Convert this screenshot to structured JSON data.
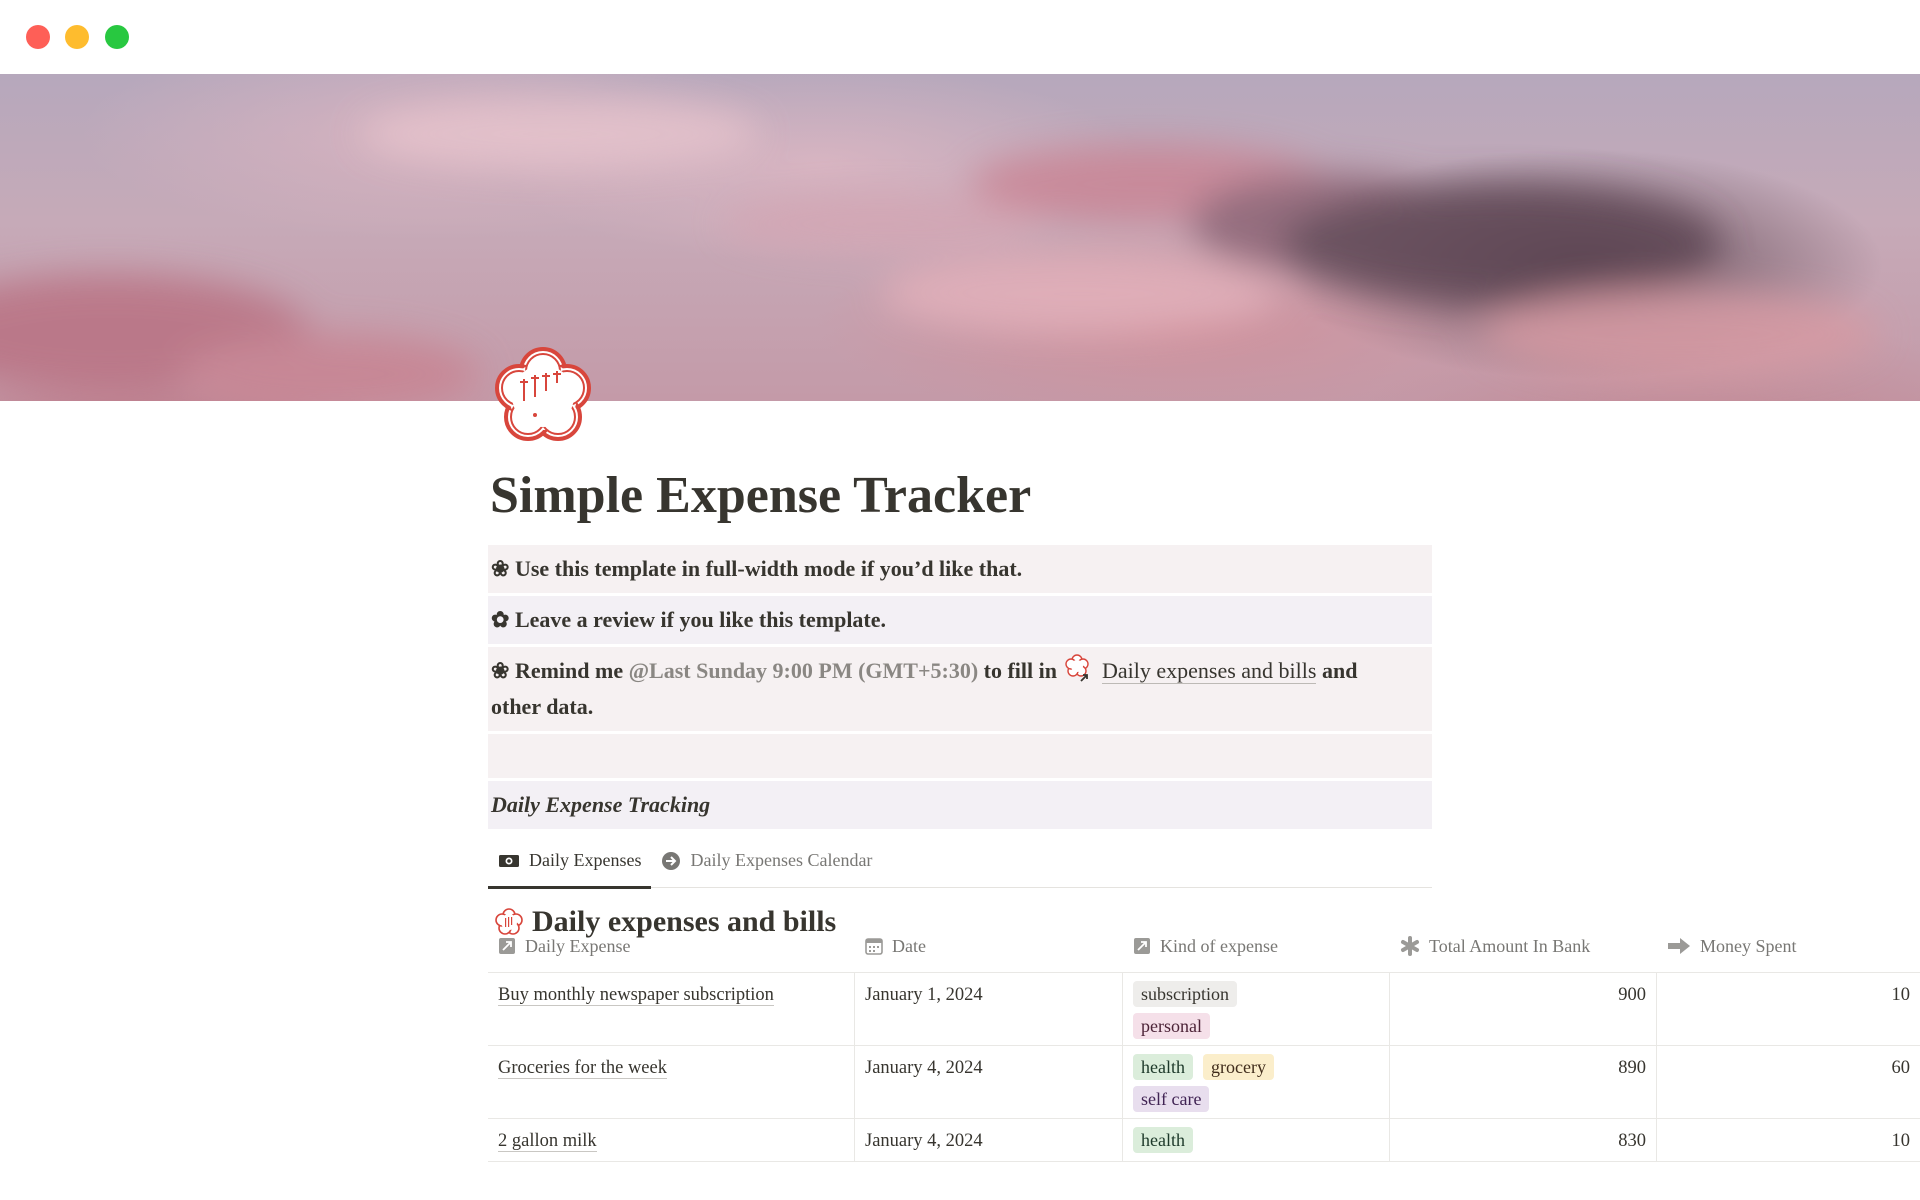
{
  "page": {
    "title": "Simple Expense Tracker",
    "icon": "sakura-stamp-icon",
    "icon_text": "大変よくできました。"
  },
  "callout": {
    "line1": "Use this template in full-width mode if you’d like that.",
    "line2": "Leave a review if you like this template.",
    "line3_prefix": "Remind me",
    "reminder": "@Last Sunday 9:00 PM (GMT+5:30)",
    "line3_middle": "to fill in",
    "linked_page": "Daily expenses and bills",
    "line3_suffix": "and",
    "line3_end": "other data.",
    "section": "Daily Expense Tracking"
  },
  "tabs": [
    {
      "label": "Daily Expenses",
      "icon": "money-icon",
      "active": true
    },
    {
      "label": "Daily Expenses Calendar",
      "icon": "arrow-circle-icon",
      "active": false
    }
  ],
  "database": {
    "title": "Daily expenses and bills",
    "columns": [
      "Daily Expense",
      "Date",
      "Kind of expense",
      "Total Amount In Bank",
      "Money Spent"
    ],
    "rows": [
      {
        "name": "Buy monthly newspaper subscription",
        "date": "January 1, 2024",
        "kinds": [
          "subscription",
          "personal"
        ],
        "bank": "900",
        "spent": "10"
      },
      {
        "name": "Groceries for the week",
        "date": "January 4, 2024",
        "kinds": [
          "health",
          "grocery",
          "self care"
        ],
        "bank": "890",
        "spent": "60"
      },
      {
        "name": "2 gallon milk",
        "date": "January 4, 2024",
        "kinds": [
          "health"
        ],
        "bank": "830",
        "spent": "10"
      }
    ]
  },
  "colors": {
    "accent_red": "#d8463c",
    "tag_subscription": "#eeedeb",
    "tag_personal": "#f5e0e9",
    "tag_health": "#dbeddb",
    "tag_grocery": "#fbeecb",
    "tag_self_care": "#e8deee"
  }
}
